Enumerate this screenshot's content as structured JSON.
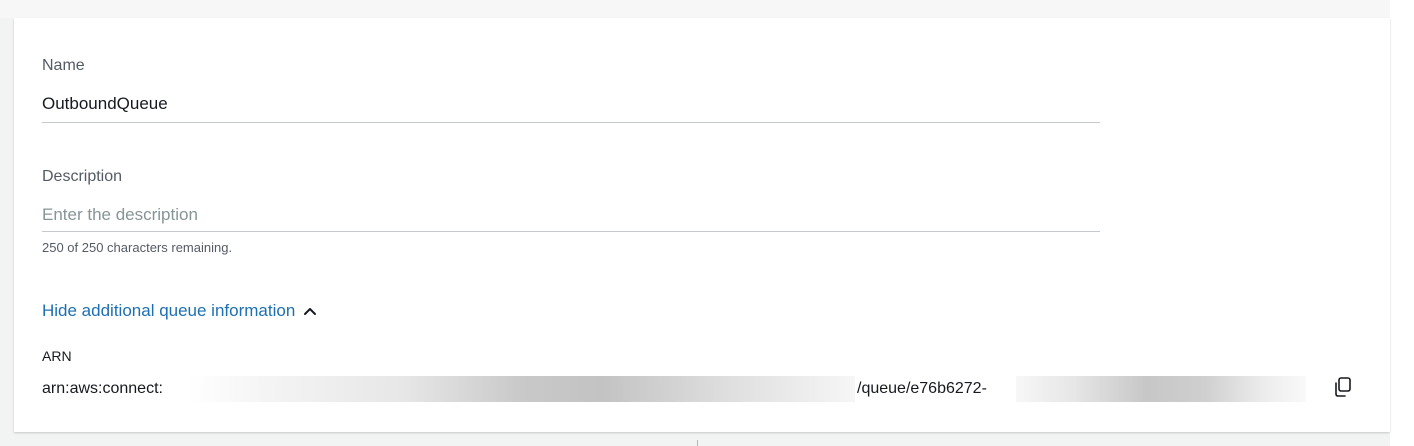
{
  "form": {
    "name": {
      "label": "Name",
      "value": "OutboundQueue"
    },
    "description": {
      "label": "Description",
      "placeholder": "Enter the description",
      "value": "",
      "counter_text": "250 of 250 characters remaining."
    },
    "toggle": {
      "label": "Hide additional queue information",
      "icon": "chevron-up-icon"
    },
    "arn": {
      "label": "ARN",
      "prefix": "arn:aws:connect:",
      "middle": "/queue/e76b6272-",
      "copy_icon": "copy-icon"
    }
  },
  "colors": {
    "link": "#1d6fb4",
    "label": "#545b64",
    "text": "#16191f",
    "placeholder": "#879596",
    "divider": "#c6c9cc"
  }
}
